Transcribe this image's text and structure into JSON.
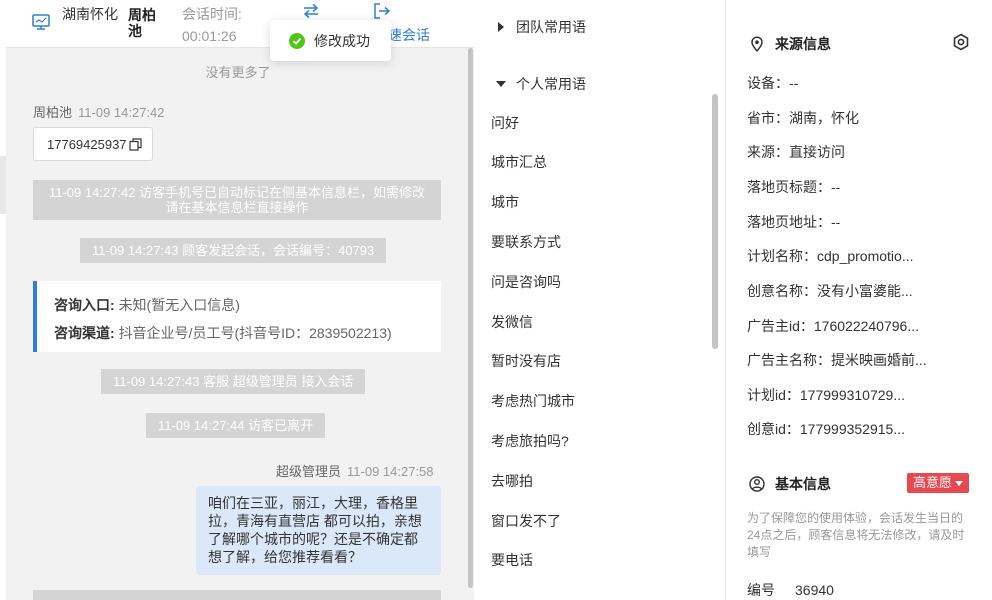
{
  "header": {
    "location": "湖南怀化",
    "visitor_name": "周柏池",
    "session_time_label": "会话时间:",
    "session_time_value": "00:01:26",
    "end_session_label": "速会话"
  },
  "toast": {
    "message": "修改成功"
  },
  "chat": {
    "no_more": "没有更多了",
    "visitor_meta": {
      "name": "周柏池",
      "time": "11-09 14:27:42"
    },
    "phone": "17769425937",
    "system_messages": [
      "11-09 14:27:42 访客手机号已自动标记在侧基本信息栏，如需修改请在基本信息栏直接操作",
      "11-09 14:27:43 顾客发起会话，会话编号：40793",
      "11-09 14:27:43 客服 超级管理员 接入会话",
      "11-09 14:27:44 访客已离开"
    ],
    "source_card": {
      "entry_label": "咨询入口:",
      "entry_value": "未知(暂无入口信息)",
      "channel_label": "咨询渠道:",
      "channel_value": "抖音企业号/员工号(抖音号ID：2839502213)"
    },
    "agent_meta": {
      "name": "超级管理员",
      "time": "11-09 14:27:58"
    },
    "agent_message": "咱们在三亚，丽江，大理，香格里拉，青海有直营店 都可以拍，亲想了解哪个城市的呢？还是不确定都想了解，给您推荐看看？"
  },
  "phrases": {
    "team_group": "团队常用语",
    "personal_group": "个人常用语",
    "items": [
      "问好",
      "城市汇总",
      "城市",
      "要联系方式",
      "问是咨询吗",
      "发微信",
      "暂时没有店",
      "考虑热门城市",
      "考虑旅拍吗?",
      "去哪拍",
      "窗口发不了",
      "要电话"
    ]
  },
  "source_info": {
    "title": "来源信息",
    "rows": [
      "设备：--",
      "省市：湖南，怀化",
      "来源：直接访问",
      "落地页标题：--",
      "落地页地址：--",
      "计划名称：cdp_promotio...",
      "创意名称：没有小富婆能...",
      "广告主id：176022240796...",
      "广告主名称：提米映画婚前...",
      "计划id：177999310729...",
      "创意id：177999352915..."
    ]
  },
  "basic_info": {
    "title": "基本信息",
    "intent_badge": "高意愿",
    "notice": "为了保障您的使用体验，会话发生当日的24点之后，顾客信息将无法修改，请及时填写",
    "serial_label": "编号",
    "serial_value": "36940"
  },
  "colors": {
    "accent": "#2f7fd8",
    "success": "#52c41a",
    "intent": "#e8484f",
    "system_bg": "#d4d4d4",
    "agent_bubble": "#dbe8fa"
  }
}
